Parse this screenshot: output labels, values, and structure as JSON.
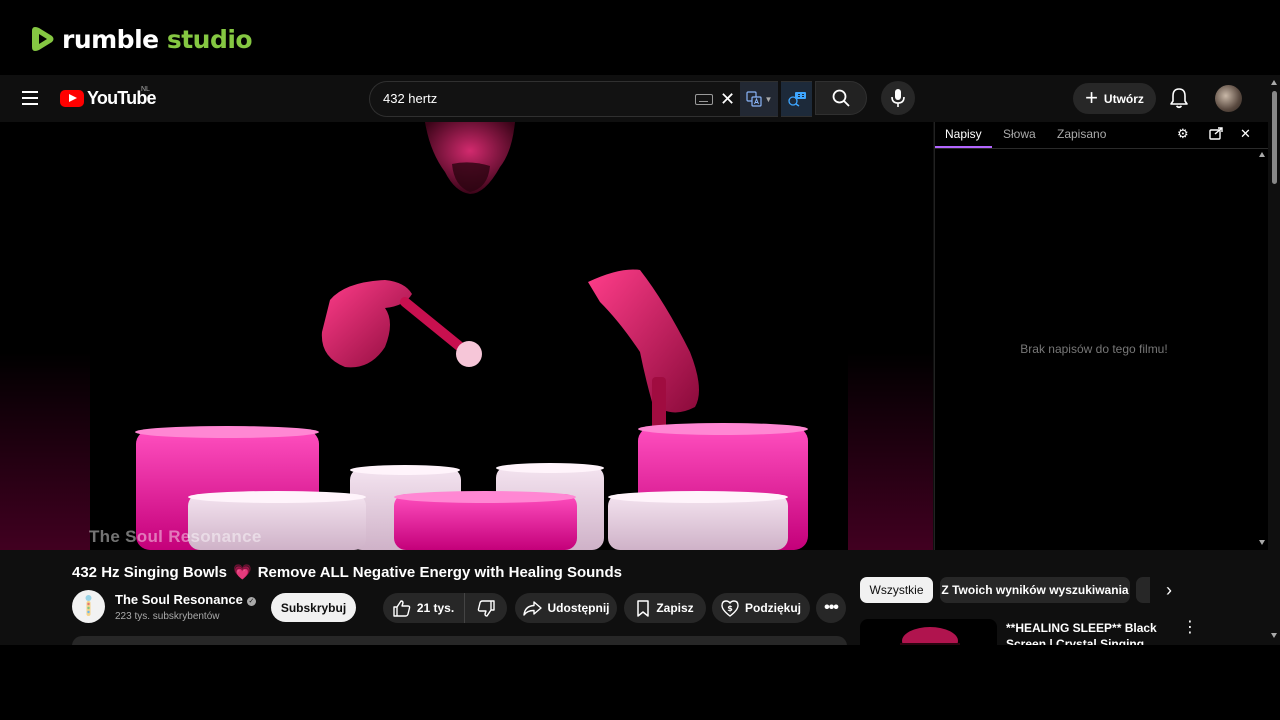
{
  "rumble": {
    "brand_word1": "rumble",
    "brand_word2": "studio",
    "brand_color": "#85c742"
  },
  "youtube": {
    "logo_text": "YouTube",
    "region_code": "NL",
    "search": {
      "query": "432 hertz"
    },
    "create_label": "Utwórz",
    "icons": [
      "menu-icon",
      "keyboard-icon",
      "clear-icon",
      "translate-icon",
      "subtitle-extension-icon",
      "search-icon",
      "microphone-icon",
      "plus-icon",
      "bell-icon"
    ]
  },
  "player": {
    "watermark": "The Soul Resonance"
  },
  "transcript_panel": {
    "tabs": [
      {
        "label": "Napisy",
        "active": true
      },
      {
        "label": "Słowa",
        "active": false
      },
      {
        "label": "Zapisano",
        "active": false
      }
    ],
    "empty_message": "Brak napisów do tego filmu!",
    "icons": [
      "settings-icon",
      "popout-icon",
      "close-icon"
    ]
  },
  "video": {
    "title_part1": "432 Hz Singing Bowls",
    "title_emoji": "💗",
    "title_part2": "Remove ALL Negative Energy with Healing Sounds",
    "channel_name": "The Soul Resonance",
    "subscribers": "223 tys. subskrybentów",
    "subscribe_label": "Subskrybuj",
    "likes": "21 tys.",
    "share_label": "Udostępnij",
    "save_label": "Zapisz",
    "thanks_label": "Podziękuj"
  },
  "chips": [
    {
      "label": "Wszystkie",
      "active": true
    },
    {
      "label": "Z Twoich wyników wyszukiwania",
      "active": false
    }
  ],
  "recommendation": {
    "title": "**HEALING SLEEP** Black Screen | Crystal Singing Bowls"
  },
  "colors": {
    "accent_pink": "#ff0a8c",
    "tab_underline": "#b366ff",
    "youtube_red": "#ff0000"
  }
}
